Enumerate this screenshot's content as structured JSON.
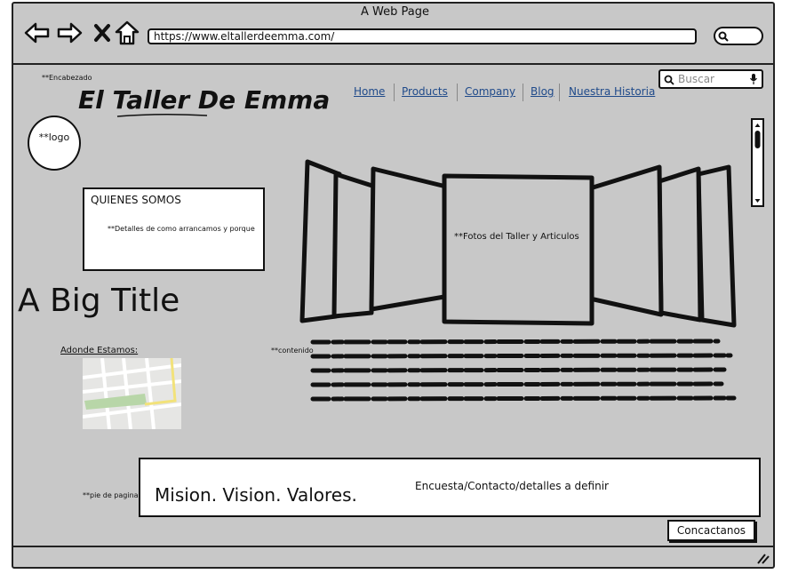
{
  "window": {
    "title": "A Web Page"
  },
  "browser": {
    "url": "https://www.eltallerdeemma.com/",
    "back_icon": "arrow-left-icon",
    "forward_icon": "arrow-right-icon",
    "stop_icon": "close-icon",
    "home_icon": "home-icon",
    "search_icon": "search-icon"
  },
  "annotations": {
    "header": "**Encabezado",
    "content": "**contenido",
    "footer": "**pie de pagina"
  },
  "site": {
    "brand": "El Taller De Emma",
    "logo": "**logo",
    "nav": [
      "Home",
      "Products",
      "Company",
      "Blog",
      "Nuestra Historia"
    ],
    "search_placeholder": "Buscar"
  },
  "about": {
    "title": "QUIENES SOMOS",
    "detail": "**Detalles de como arrancamos y porque"
  },
  "carousel": {
    "caption": "**Fotos del Taller y Articulos"
  },
  "big_title": "A Big Title",
  "location": {
    "label": "Adonde Estamos:"
  },
  "footer": {
    "mission": "Mision. Vision. Valores.",
    "contact_text": "Encuesta/Contacto/detalles a definir",
    "contact_button": "Concactanos"
  },
  "colors": {
    "link": "#1f4a8a",
    "window_bg": "#c8c8c8"
  }
}
